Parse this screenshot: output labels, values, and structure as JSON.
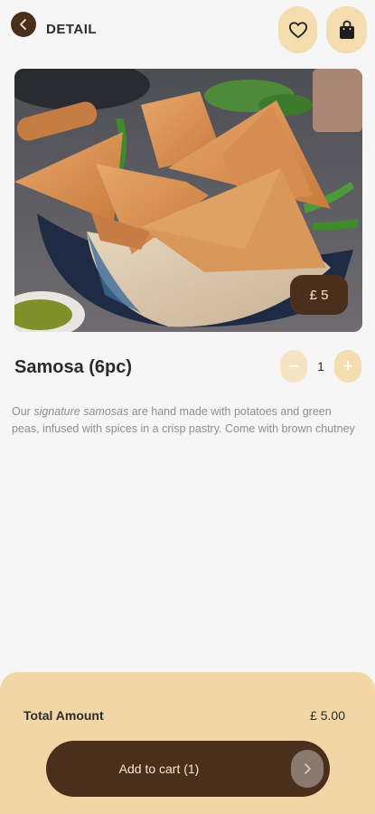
{
  "header": {
    "title": "DETAIL",
    "back_icon": "chevron-left-icon",
    "favorite_icon": "heart-icon",
    "bag_icon": "shopping-bag-icon"
  },
  "product": {
    "image_alt": "Samosas in a basket with green chutney",
    "price_badge": "£ 5",
    "name": "Samosa (6pc)",
    "quantity": "1",
    "decrement_label": "−",
    "increment_label": "+",
    "description_pre": "Our ",
    "description_em": "signature samosas",
    "description_post": " are hand made with potatoes and green peas, infused with spices in a crisp pastry. Come with brown chutney"
  },
  "footer": {
    "total_label": "Total Amount",
    "total_value": "£ 5.00",
    "add_to_cart_label": "Add to cart (1)",
    "arrow_icon": "chevron-right-icon"
  },
  "colors": {
    "brand_dark": "#4a2f1d",
    "accent_light": "#f3dcae",
    "footer_bg": "#f3d6a5",
    "background": "#f6f6f6"
  }
}
